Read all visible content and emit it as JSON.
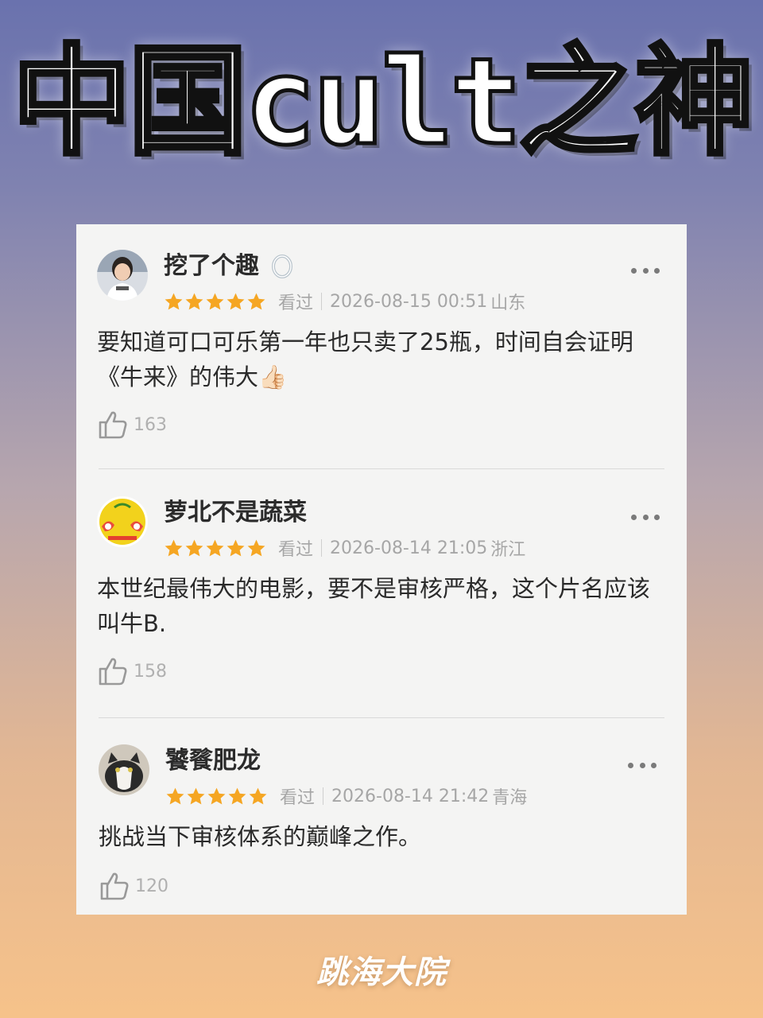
{
  "title": "中国cult之神",
  "reviews": [
    {
      "username": "挖了个趣",
      "badge_icon": "ring-icon",
      "rating": 5,
      "status": "看过",
      "datetime": "2026-08-15 00:51",
      "location": "山东",
      "content": "要知道可口可乐第一年也只卖了25瓶，时间自会证明《牛来》的伟大👍🏻",
      "likes": "163",
      "avatar": "person-avatar"
    },
    {
      "username": "萝北不是蔬菜",
      "rating": 5,
      "status": "看过",
      "datetime": "2026-08-14 21:05",
      "location": "浙江",
      "content": "本世纪最伟大的电影，要不是审核严格，这个片名应该叫牛B.",
      "likes": "158",
      "avatar": "cartoon-avatar"
    },
    {
      "username": "饕餮肥龙",
      "rating": 5,
      "status": "看过",
      "datetime": "2026-08-14 21:42",
      "location": "青海",
      "content": "挑战当下审核体系的巅峰之作。",
      "likes": "120",
      "avatar": "cat-avatar"
    }
  ],
  "colors": {
    "star": "#f5a623",
    "text": "#2a2a2a",
    "meta": "#a6a6a6",
    "card": "#f4f4f3"
  },
  "watermark": "跳海大院"
}
